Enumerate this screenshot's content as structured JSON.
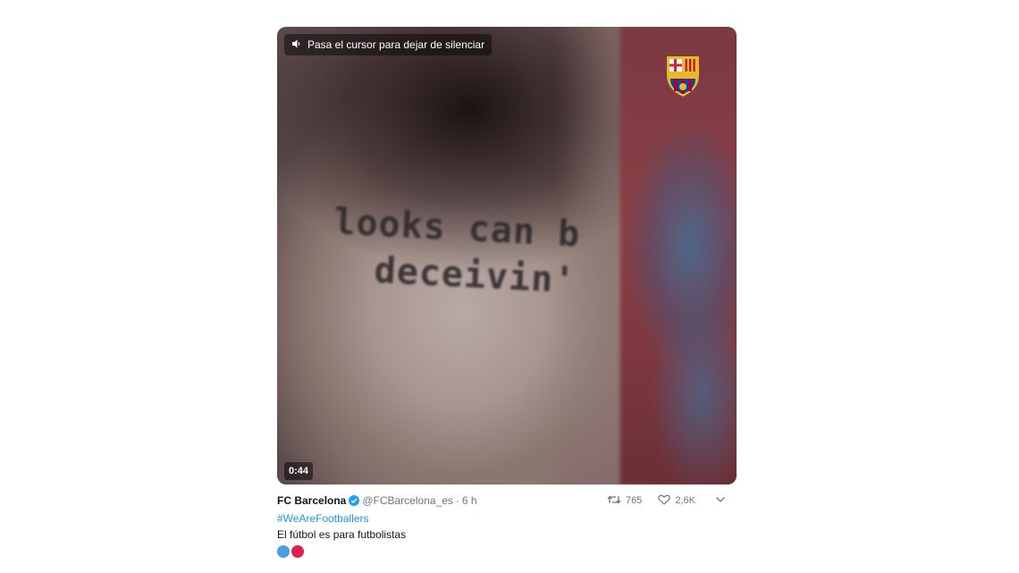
{
  "video": {
    "mute_hint": "Pasa el cursor para dejar de silenciar",
    "duration": "0:44",
    "tattoo_line1": "looks can b",
    "tattoo_line2": "deceivin'",
    "crest_label": "FCB"
  },
  "tweet": {
    "author_name": "FC Barcelona",
    "handle": "@FCBarcelona_es",
    "separator": "·",
    "time": "6 h",
    "retweet_count": "765",
    "like_count": "2,6K",
    "hashtag": "#WeAreFootballers",
    "text": "El fútbol es para futbolistas",
    "emoji_dots": [
      "#4a9fe0",
      "#d9214a"
    ]
  },
  "colors": {
    "link": "#1b95e0",
    "muted": "#657786",
    "verified": "#1da1f2"
  }
}
